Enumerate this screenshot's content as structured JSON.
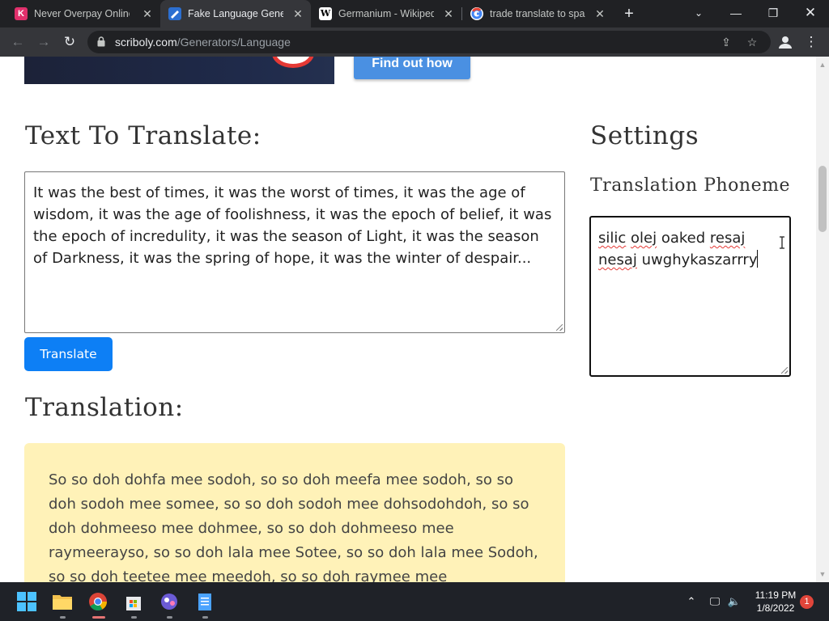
{
  "browser": {
    "tabs": [
      {
        "title": "Never Overpay Online",
        "favicon": "K",
        "active": false
      },
      {
        "title": "Fake Language Generator",
        "favicon": "scriboly",
        "active": true
      },
      {
        "title": "Germanium - Wikipedia",
        "favicon": "W",
        "active": false
      },
      {
        "title": "trade translate to spanish",
        "favicon": "G",
        "active": false
      }
    ],
    "url_domain": "scriboly.com",
    "url_path": "/Generators/Language"
  },
  "ad": {
    "button_label": "Find out how"
  },
  "main": {
    "heading": "Text To Translate:",
    "source_text": "It was the best of times, it was the worst of times, it was the age of wisdom, it was the age of foolishness, it was the epoch of belief, it was the epoch of incredulity, it was the season of Light, it was the season of Darkness, it was the spring of hope, it was the winter of despair...",
    "translate_button": "Translate",
    "translation_heading": "Translation:",
    "translation_text": "So so doh dohfa mee sodoh, so so doh meefa mee sodoh, so so doh sodoh mee somee, so so doh sodoh mee dohsodohdoh, so so doh dohmeeso mee dohmee, so so doh dohmeeso mee raymeerayso, so so doh lala mee Sotee, so so doh lala mee Sodoh, so so doh teetee mee meedoh, so so doh raymee mee"
  },
  "settings": {
    "heading": "Settings",
    "phoneme_label": "Translation Phoneme",
    "phoneme_words": [
      "silic",
      "olej",
      "oaked",
      "resaj",
      "nesaj",
      "uwghykaszarrry"
    ]
  },
  "taskbar": {
    "time": "11:19 PM",
    "date": "1/8/2022",
    "notification_count": "1"
  },
  "colors": {
    "primary_button": "#0d7ff5",
    "translation_bg": "#fff2b8",
    "chrome_dark": "#202124"
  }
}
